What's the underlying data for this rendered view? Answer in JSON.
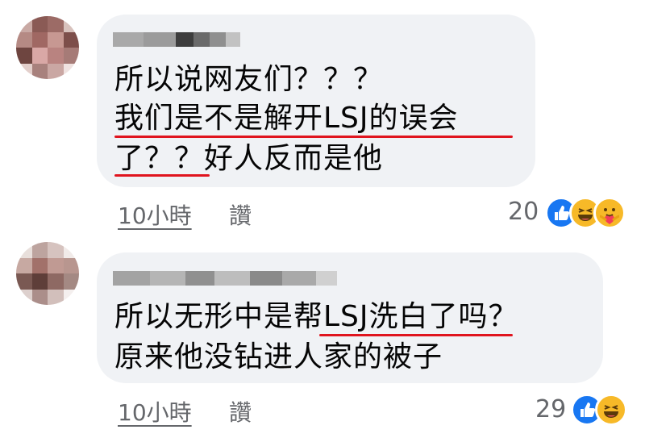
{
  "comments": [
    {
      "lines": [
        "所以说网友们？？？",
        "我们是不是解开LSJ的误会",
        "了？？好人反而是他"
      ],
      "time": "10小時",
      "like_label": "讚",
      "reaction_count": "20",
      "reactions": [
        "like-icon",
        "haha-icon",
        "care-icon"
      ]
    },
    {
      "lines": [
        "所以无形中是帮LSJ洗白了吗？",
        "原来他没钻进人家的被子"
      ],
      "time": "10小時",
      "like_label": "讚",
      "reaction_count": "29",
      "reactions": [
        "like-icon",
        "haha-icon"
      ]
    }
  ],
  "colors": {
    "bubble": "#f0f2f5",
    "underline": "#e0141e",
    "like": "#1877f2",
    "haha": "#f7b928",
    "meta": "#65676b"
  }
}
